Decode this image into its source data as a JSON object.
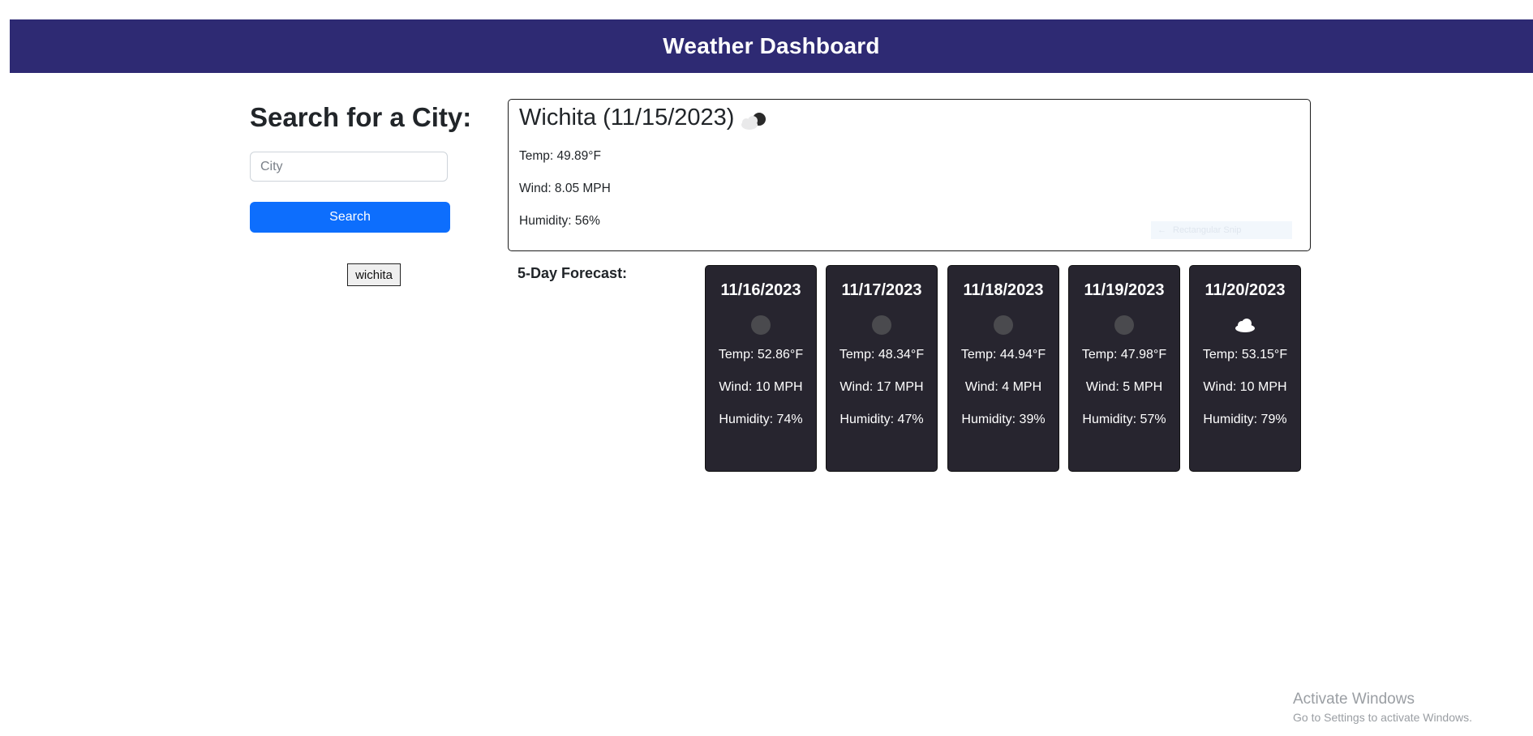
{
  "header": {
    "title": "Weather Dashboard"
  },
  "search": {
    "title": "Search for a City:",
    "placeholder": "City",
    "value": "",
    "button_label": "Search",
    "history": [
      "wichita"
    ]
  },
  "current": {
    "title": "Wichita (11/15/2023)",
    "icon": "partly-cloudy-icon",
    "temp": "Temp: 49.89°F",
    "wind": "Wind: 8.05 MPH",
    "humidity": "Humidity: 56%"
  },
  "snip_overlay": {
    "label": "Rectangular Snip"
  },
  "forecast": {
    "label": "5-Day Forecast:",
    "days": [
      {
        "date": "11/16/2023",
        "icon": "dark-circle-icon",
        "temp": "Temp: 52.86°F",
        "wind": "Wind: 10 MPH",
        "humidity": "Humidity: 74%"
      },
      {
        "date": "11/17/2023",
        "icon": "dark-circle-icon",
        "temp": "Temp: 48.34°F",
        "wind": "Wind: 17 MPH",
        "humidity": "Humidity: 47%"
      },
      {
        "date": "11/18/2023",
        "icon": "dark-circle-icon",
        "temp": "Temp: 44.94°F",
        "wind": "Wind: 4 MPH",
        "humidity": "Humidity: 39%"
      },
      {
        "date": "11/19/2023",
        "icon": "dark-circle-icon",
        "temp": "Temp: 47.98°F",
        "wind": "Wind: 5 MPH",
        "humidity": "Humidity: 57%"
      },
      {
        "date": "11/20/2023",
        "icon": "cloud-icon",
        "temp": "Temp: 53.15°F",
        "wind": "Wind: 10 MPH",
        "humidity": "Humidity: 79%"
      }
    ]
  },
  "watermark": {
    "line1": "Activate Windows",
    "line2": "Go to Settings to activate Windows."
  }
}
